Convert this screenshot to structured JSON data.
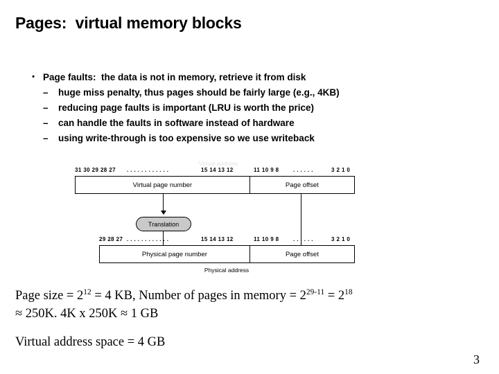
{
  "slide": {
    "title": "Pages:  virtual memory blocks",
    "page_number": "3"
  },
  "bullets": {
    "level1_marker": "•",
    "level2_marker": "–",
    "level1": "Page faults:  the data is not in memory, retrieve it from disk",
    "level2": [
      "huge miss penalty, thus pages should be fairly large (e.g., 4KB)",
      "reducing page faults is important (LRU is worth the price)",
      "can handle the faults in software instead of hardware",
      "using write-through is too expensive so we use writeback"
    ]
  },
  "diagram": {
    "virtual_address_label": "Virtual address",
    "physical_address_label": "Physical address",
    "translation_label": "Translation",
    "virtual_bits": {
      "high": "31 30 29 28 27",
      "dots1": ". . . . . . . . . . . .",
      "mid": "15 14 13 12",
      "offset_high": "11 10 9 8",
      "dots2": ". . . . . .",
      "offset_low": "3 2 1 0"
    },
    "physical_bits": {
      "high": "29 28 27",
      "dots1": ". . . . . . . . . . . .",
      "mid": "15 14 13 12",
      "offset_high": "11 10 9 8",
      "dots2": ". . . . . .",
      "offset_low": "3 2 1 0"
    },
    "virtual_fields": {
      "page_number": "Virtual page number",
      "page_offset": "Page offset"
    },
    "physical_fields": {
      "page_number": "Physical page number",
      "page_offset": "Page offset"
    }
  },
  "notes": {
    "line1_a": "Page size = 2",
    "line1_sup1": "12",
    "line1_b": " = 4 KB, Number of pages in memory = 2",
    "line1_sup2": "29-11",
    "line1_c": " = 2",
    "line1_sup3": "18",
    "line2": "≈ 250K. 4K x 250K ≈ 1 GB",
    "line3": "Virtual address space = 4 GB"
  }
}
